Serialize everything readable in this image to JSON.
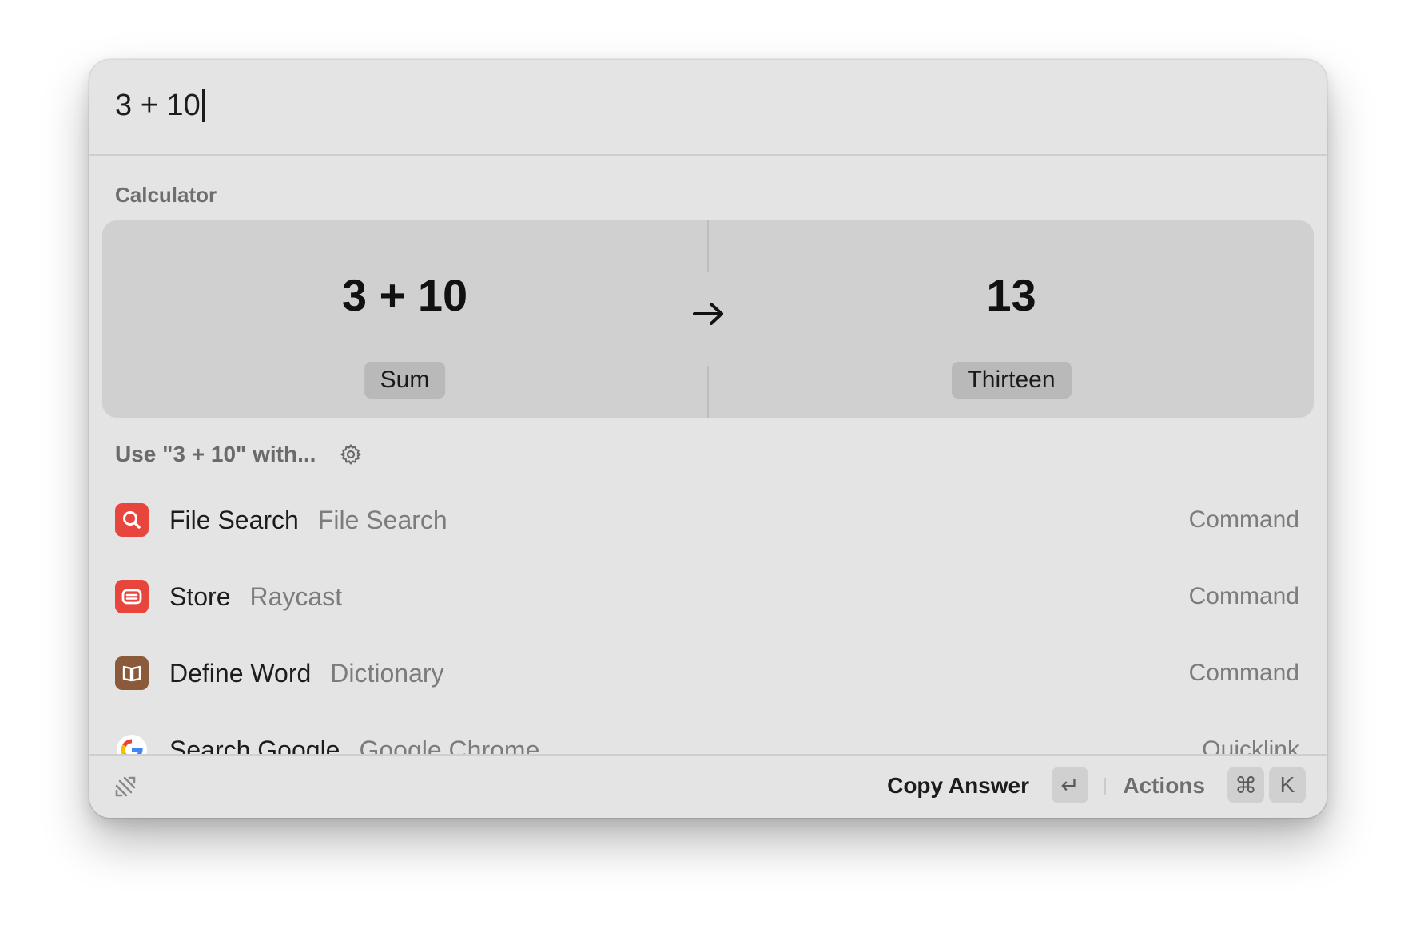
{
  "search": {
    "query": "3 + 10"
  },
  "calculator": {
    "section_label": "Calculator",
    "expression": "3 + 10",
    "expression_label": "Sum",
    "result": "13",
    "result_label": "Thirteen"
  },
  "use_with": {
    "label": "Use \"3 + 10\" with..."
  },
  "items": [
    {
      "title": "File Search",
      "subtitle": "File Search",
      "type": "Command",
      "icon": "magnifier-icon",
      "icon_color": "#e8453c"
    },
    {
      "title": "Store",
      "subtitle": "Raycast",
      "type": "Command",
      "icon": "store-icon",
      "icon_color": "#e8453c"
    },
    {
      "title": "Define Word",
      "subtitle": "Dictionary",
      "type": "Command",
      "icon": "book-icon",
      "icon_color": "#8a5a3a"
    },
    {
      "title": "Search Google",
      "subtitle": "Google Chrome",
      "type": "Quicklink",
      "icon": "google-icon",
      "icon_color": "#ffffff"
    }
  ],
  "footer": {
    "primary_action": "Copy Answer",
    "primary_shortcut": "↵",
    "actions_label": "Actions",
    "actions_shortcut_modifier": "⌘",
    "actions_shortcut_key": "K"
  }
}
